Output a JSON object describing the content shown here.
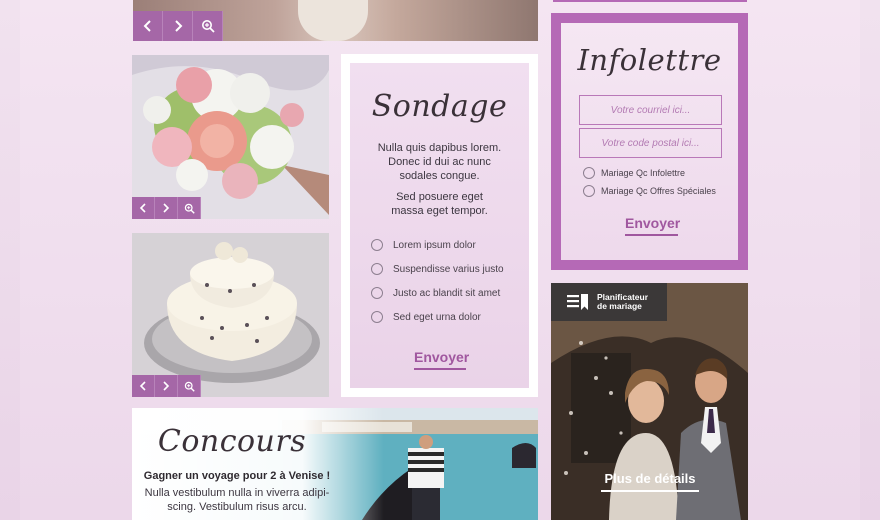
{
  "sondage": {
    "title": "Sondage",
    "text1": "Nulla quis dapibus lorem. Donec id dui ac nunc sodales congue.",
    "text2": "Sed posuere eget massa eget tempor.",
    "options": [
      "Lorem ipsum dolor",
      "Suspendisse varius justo",
      "Justo ac blandit sit amet",
      "Sed eget urna dolor"
    ],
    "submit": "Envoyer"
  },
  "infolettre": {
    "title": "Infolettre",
    "email_placeholder": "Votre courriel ici...",
    "postal_placeholder": "Votre code postal ici...",
    "options": [
      "Mariage Qc Infolettre",
      "Mariage Qc Offres Spéciales"
    ],
    "submit": "Envoyer"
  },
  "planner": {
    "badge_line1": "Planificateur",
    "badge_line2": "de mariage",
    "cta": "Plus de détails"
  },
  "concours": {
    "title": "Concours",
    "subtitle": "Gagner un voyage pour 2 à Venise !",
    "text": "Nulla vestibulum nulla in viverra adipi-scing. Vestibulum risus arcu."
  },
  "colors": {
    "accent": "#a567a7",
    "infolettre_border": "#b569b6",
    "button_text": "#a0579f",
    "background": "#f1e2ef"
  },
  "icons": [
    "chevron-left-icon",
    "chevron-right-icon",
    "zoom-in-icon",
    "bookmark-list-icon"
  ]
}
